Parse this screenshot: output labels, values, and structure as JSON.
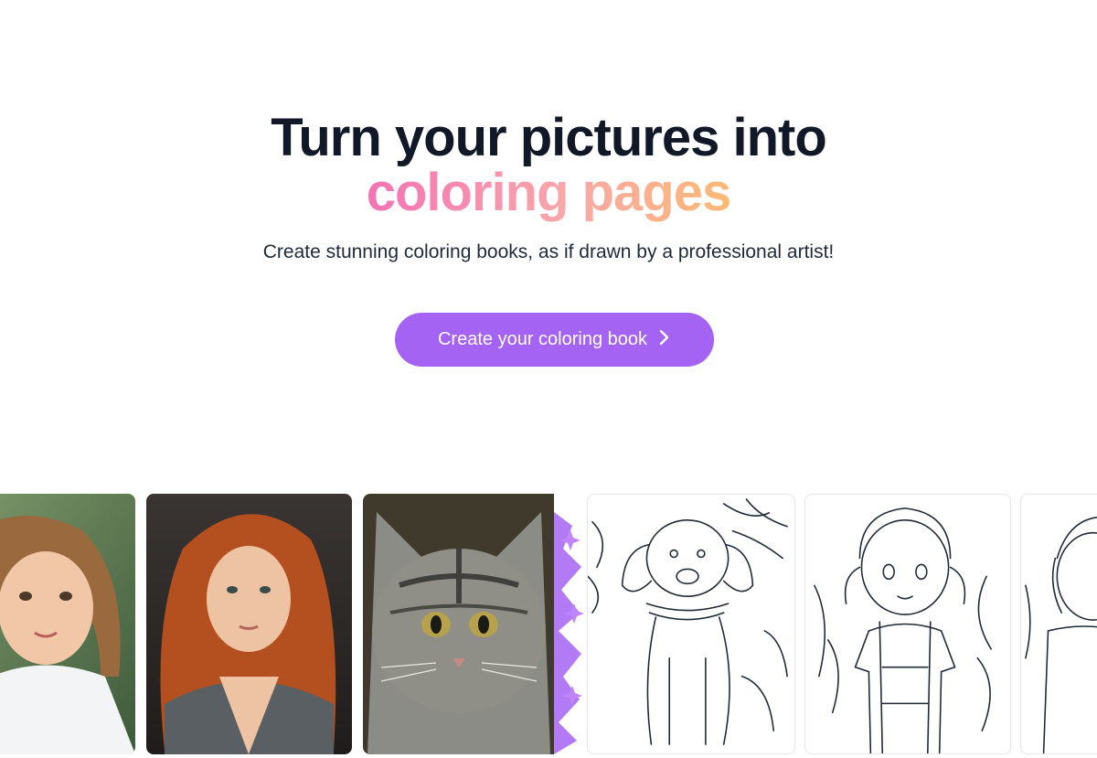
{
  "hero": {
    "headline_line1": "Turn your pictures into",
    "headline_line2": "coloring pages",
    "subtitle": "Create stunning coloring books, as if drawn by a professional artist!",
    "cta_label": "Create your coloring book",
    "cta_icon": "chevron-right-icon"
  },
  "colors": {
    "heading": "#111827",
    "accent_button": "#a463f2",
    "gradient_start": "#f472b6",
    "gradient_end": "#fdba74"
  },
  "gallery": {
    "items": [
      {
        "kind": "photo",
        "subject": "girl"
      },
      {
        "kind": "photo",
        "subject": "red-haired woman"
      },
      {
        "kind": "photo",
        "subject": "tabby cat"
      },
      {
        "kind": "sketch",
        "subject": "dog"
      },
      {
        "kind": "sketch",
        "subject": "girl in overalls"
      },
      {
        "kind": "sketch",
        "subject": "girl"
      }
    ]
  }
}
